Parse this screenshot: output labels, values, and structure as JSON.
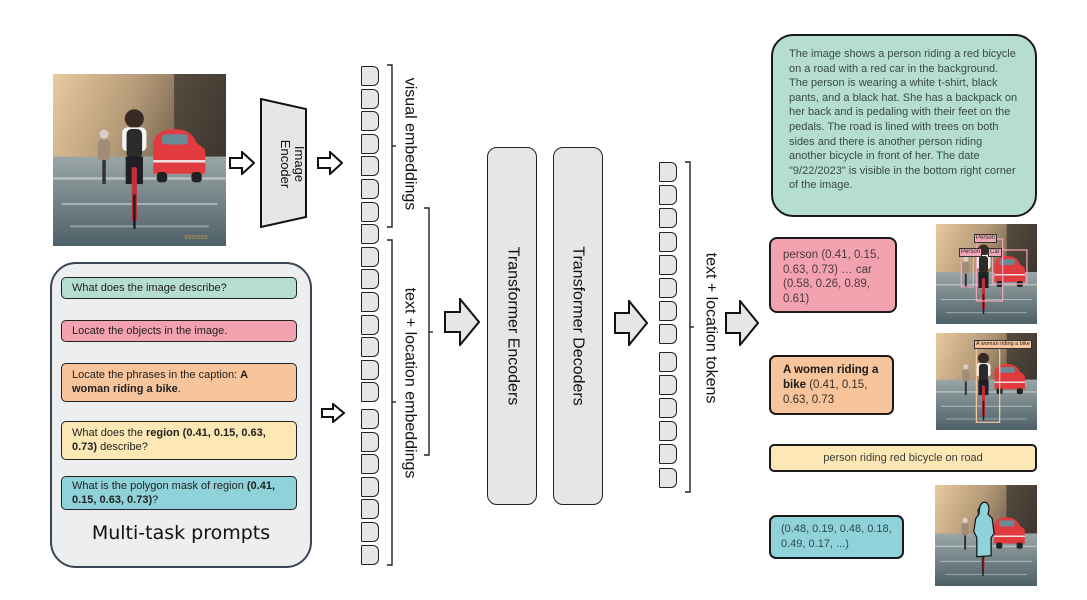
{
  "input_image": {
    "description": "person riding red bicycle with red car on tree-lined road"
  },
  "image_encoder": {
    "label_line1": "Image",
    "label_line2": "Encoder"
  },
  "embeddings": {
    "visual_label": "visual embeddings",
    "text_location_label": "text + location embeddings"
  },
  "prompts": {
    "title": "Multi-task prompts",
    "items": [
      {
        "id": "caption",
        "color": "#b5ddd0",
        "parts": [
          {
            "text": "What does the image describe?",
            "bold": false
          }
        ]
      },
      {
        "id": "detect",
        "color": "#f3a3b0",
        "parts": [
          {
            "text": "Locate the objects in the image.",
            "bold": false
          }
        ]
      },
      {
        "id": "ground",
        "color": "#f7c49b",
        "parts": [
          {
            "text": "Locate the phrases in the caption: ",
            "bold": false
          },
          {
            "text": "A woman riding a bike",
            "bold": true
          },
          {
            "text": ".",
            "bold": false
          }
        ]
      },
      {
        "id": "region",
        "color": "#fde8b5",
        "parts": [
          {
            "text": "What does the ",
            "bold": false
          },
          {
            "text": "region (0.41, 0.15, 0.63, 0.73)",
            "bold": true
          },
          {
            "text": " describe?",
            "bold": false
          }
        ]
      },
      {
        "id": "polygon",
        "color": "#8fd2da",
        "parts": [
          {
            "text": "What is the polygon mask of region ",
            "bold": false
          },
          {
            "text": "(0.41, 0.15, 0.63, 0.73)",
            "bold": true
          },
          {
            "text": "?",
            "bold": false
          }
        ]
      }
    ]
  },
  "transformer": {
    "encoders_label": "Transformer Encoders",
    "decoders_label": "Transformer Decoders"
  },
  "output_tokens": {
    "label": "text + location tokens"
  },
  "outputs": {
    "caption": "The image shows a person riding a red bicycle on a road with a red car in the background. The person is wearing a white t-shirt, black pants, and a black hat. She has a backpack on her back and is pedaling with their feet on the pedals. The road is lined with trees on both sides and there is another person riding another bicycle in front of her. The date \"9/22/2023\" is visible in the bottom right corner of the image.",
    "detection": "person (0.41, 0.15, 0.63, 0.73) … car (0.58, 0.26, 0.89, 0.61)",
    "grounding": {
      "phrase": "A women riding a bike",
      "coords": " (0.41, 0.15, 0.63, 0.73"
    },
    "region_caption": "person riding red bicycle on road",
    "polygon": "(0.48, 0.19, 0.48, 0.18, 0.49, 0.17, ...)"
  },
  "result_images": {
    "detection_labels": [
      "Person",
      "Person",
      "Car"
    ],
    "grounding_label": "A woman riding a bike"
  },
  "colors": {
    "caption": "#b5ddd0",
    "detect": "#f3a3b0",
    "ground": "#f7c49b",
    "region": "#fde8b5",
    "polygon": "#8fd2da",
    "panel": "#eceef0",
    "token": "#e6e6e6"
  }
}
